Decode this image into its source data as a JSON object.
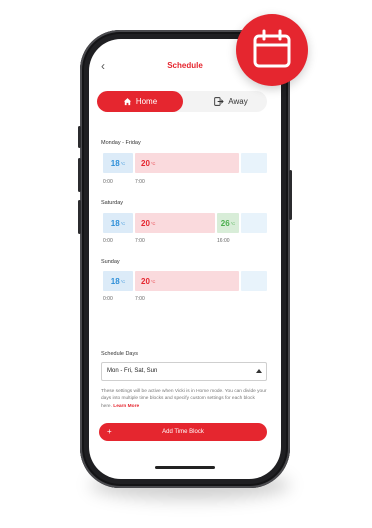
{
  "header": {
    "title": "Schedule",
    "back_icon": "chevron-left-icon"
  },
  "mode_toggle": {
    "home_label": "Home",
    "away_label": "Away",
    "selected": "Home",
    "home_icon": "house-icon",
    "away_icon": "exit-icon"
  },
  "schedule": [
    {
      "label": "Monday - Friday",
      "blocks": [
        {
          "temp": "18",
          "unit": "°C"
        },
        {
          "temp": "20",
          "unit": "°C"
        }
      ],
      "times": [
        "0:00",
        "7:00"
      ]
    },
    {
      "label": "Saturday",
      "blocks": [
        {
          "temp": "18",
          "unit": "°C"
        },
        {
          "temp": "20",
          "unit": "°C"
        },
        {
          "temp": "26",
          "unit": "°C"
        }
      ],
      "times": [
        "0:00",
        "7:00",
        "16:00"
      ]
    },
    {
      "label": "Sunday",
      "blocks": [
        {
          "temp": "18",
          "unit": "°C"
        },
        {
          "temp": "20",
          "unit": "°C"
        }
      ],
      "times": [
        "0:00",
        "7:00"
      ]
    }
  ],
  "schedule_days": {
    "label": "Schedule Days",
    "selected": "Mon - Fri, Sat, Sun"
  },
  "help": {
    "text": "These settings will be active when Vicki is in Home mode. You can divide your days into multiple time blocks and specify custom settings for each block here.",
    "link": "Learn More"
  },
  "add_button": {
    "label": "Add Time Block",
    "icon": "plus-icon"
  },
  "badge": {
    "icon": "calendar-icon"
  },
  "colors": {
    "accent": "#e5262f",
    "cold": "#2f8fd8",
    "warm": "#e5262f",
    "mild": "#4caf50"
  }
}
